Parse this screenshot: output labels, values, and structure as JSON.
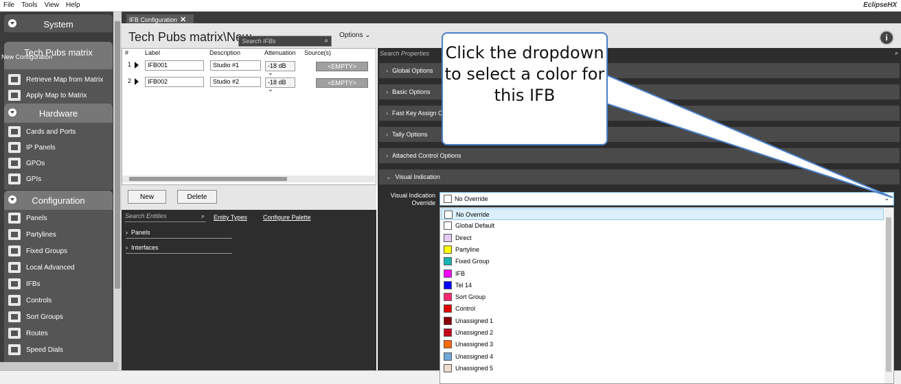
{
  "menu": [
    "File",
    "Tools",
    "View",
    "Help"
  ],
  "brand": "EclipseHX",
  "sidebar": {
    "system_label": "System",
    "project": {
      "title": "Tech Pubs matrix",
      "config": "New Configuration"
    },
    "project_items": [
      "Retrieve Map from Matrix",
      "Apply Map to Matrix"
    ],
    "hardware_label": "Hardware",
    "hardware_items": [
      "Cards and Ports",
      "IP Panels",
      "GPOs",
      "GPIs"
    ],
    "configuration_label": "Configuration",
    "configuration_items": [
      "Panels",
      "Partylines",
      "Fixed Groups",
      "Local Advanced",
      "IFBs",
      "Controls",
      "Sort Groups",
      "Routes",
      "Speed Dials"
    ]
  },
  "tab": {
    "label": "IFB Configuration",
    "close": "✕"
  },
  "header": {
    "title": "Tech Pubs matrix\\New",
    "search_placeholder": "Search IFBs",
    "options_label": "Options",
    "options_caret": "⌄",
    "info_icon": "i"
  },
  "table": {
    "columns": [
      "#",
      "Label",
      "Description",
      "Attenuation",
      "Source(s)"
    ],
    "rows": [
      {
        "num": "1",
        "label": "IFB001",
        "description": "Studio #1",
        "attenuation": "-18 dB",
        "source": "<EMPTY>"
      },
      {
        "num": "2",
        "label": "IFB002",
        "description": "Studio #2",
        "attenuation": "-18 dB",
        "source": "<EMPTY>"
      }
    ]
  },
  "buttons": {
    "new": "New",
    "delete": "Delete"
  },
  "entities": {
    "search_placeholder": "Search Entities",
    "links": [
      "Entity Types",
      "Configure Palette"
    ],
    "tree": [
      "Panels",
      "Interfaces"
    ]
  },
  "properties": {
    "search_placeholder": "Search Properties",
    "groups": [
      "Global Options",
      "Basic Options",
      "Fast Key Assign C",
      "Tally Options",
      "Attached Control Options",
      "Visual Indication"
    ],
    "visual_indication_label": "Visual Indication Override",
    "selected": "No Override"
  },
  "dropdown": [
    {
      "label": "No Override",
      "color": "#ffffff"
    },
    {
      "label": "Global Default",
      "color": "#ffffff"
    },
    {
      "label": "Direct",
      "color": "#e6c8f0"
    },
    {
      "label": "Partyline",
      "color": "#ffff00"
    },
    {
      "label": "Fixed Group",
      "color": "#1ab3b3"
    },
    {
      "label": "IFB",
      "color": "#ff00ff"
    },
    {
      "label": "Tel 14",
      "color": "#0000ff"
    },
    {
      "label": "Sort Group",
      "color": "#ff2a6d"
    },
    {
      "label": "Control",
      "color": "#e00000"
    },
    {
      "label": "Unassigned 1",
      "color": "#8b0000"
    },
    {
      "label": "Unassigned 2",
      "color": "#c4001a"
    },
    {
      "label": "Unassigned 3",
      "color": "#ff6a00"
    },
    {
      "label": "Unassigned 4",
      "color": "#6fa8dc"
    },
    {
      "label": "Unassigned 5",
      "color": "#e8ddd0"
    }
  ],
  "callout": {
    "text": "Click the dropdown to select a color for this IFB"
  }
}
